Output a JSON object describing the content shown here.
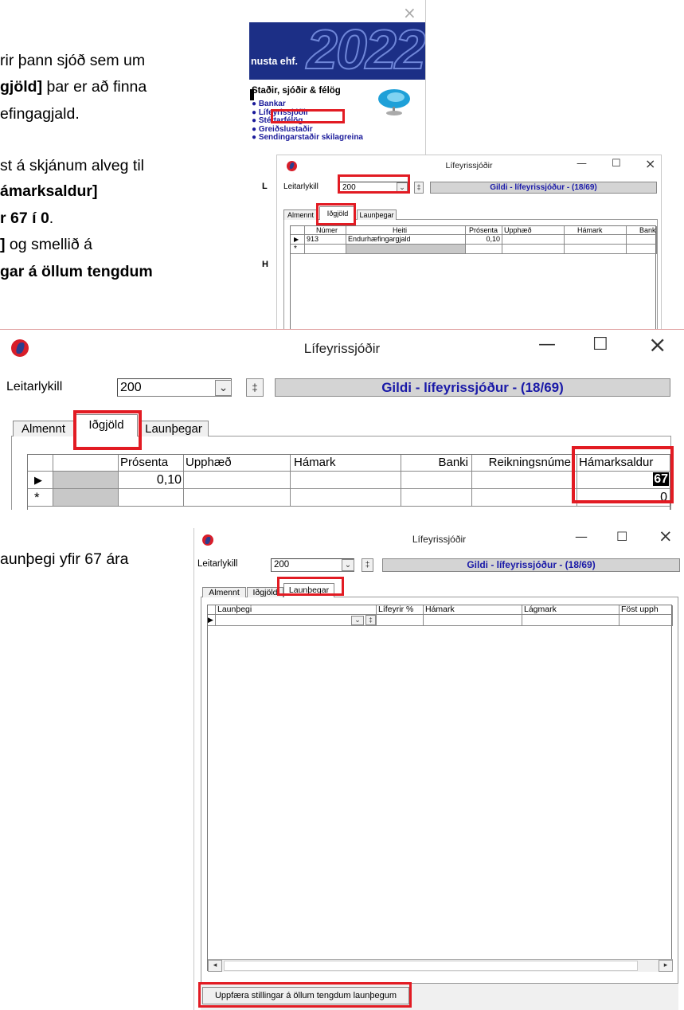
{
  "instructions": {
    "line1": "rir þann sjóð sem um",
    "line2_bold": "gjöld]",
    "line2_rest": " þar er að finna",
    "line3": "efingagjald.",
    "line4": "st á skjánum alveg til",
    "line5_bold": "ámarksaldur]",
    "line6_bold": "r 67 í 0",
    "line6_rest": ".",
    "line7_bold": "]",
    "line7_rest": " og smellið á",
    "line8_bold": "gar á öllum tengdum",
    "line9": "aunþegi yfir 67 ára"
  },
  "top_window": {
    "close_glyph": "×",
    "banner_company": "nusta ehf.",
    "banner_year": "2022",
    "menu_heading": "Staðir, sjóðir & félög",
    "menu_items": [
      "Bankar",
      "Lífeyrissjóðir",
      "Stéttarfélög",
      "Greiðslustaðir",
      "Sendingarstaðir skilagreina"
    ],
    "side_letters": [
      "L",
      "H"
    ]
  },
  "small_window": {
    "title": "Lífeyrissjóðir",
    "search_label": "Leitarlykill",
    "search_value": "200",
    "status_text": "Gildi - lífeyrissjóður  -  (18/69)",
    "tabs": [
      "Almennt",
      "Iðgjöld",
      "Launþegar"
    ],
    "columns": [
      "Númer",
      "Heiti",
      "Prósenta",
      "Upphæð",
      "Hámark",
      "Banki"
    ],
    "row": {
      "numer": "913",
      "heiti": "Endurhæfingargjald",
      "prosenta": "0,10"
    },
    "new_row_marker": "*"
  },
  "middle_window": {
    "title": "Lífeyrissjóðir",
    "search_label": "Leitarlykill",
    "search_value": "200",
    "status_text": "Gildi - lífeyrissjóður  -  (18/69)",
    "tabs": [
      "Almennt",
      "Iðgjöld",
      "Launþegar"
    ],
    "columns": [
      "Prósenta",
      "Upphæð",
      "Hámark",
      "Banki",
      "Reikningsnúmer",
      "Hámarksaldur"
    ],
    "row": {
      "prosenta": "0,10",
      "hamarksaldur": "67"
    },
    "new_row_value": "0",
    "new_row_marker": "*"
  },
  "bottom_window": {
    "title": "Lífeyrissjóðir",
    "search_label": "Leitarlykill",
    "search_value": "200",
    "status_text": "Gildi - lífeyrissjóður  -  (18/69)",
    "tabs": [
      "Almennt",
      "Iðgjöld",
      "Launþegar"
    ],
    "columns": [
      "Launþegi",
      "Lífeyrir %",
      "Hámark",
      "Lágmark",
      "Föst upph"
    ],
    "update_button": "Uppfæra stillingar á öllum tengdum launþegum"
  },
  "colors": {
    "highlight_red": "#e21b23",
    "status_blue": "#1a1aa8",
    "banner_navy": "#1c2f86",
    "menu_link_blue": "#1a1a9a"
  }
}
